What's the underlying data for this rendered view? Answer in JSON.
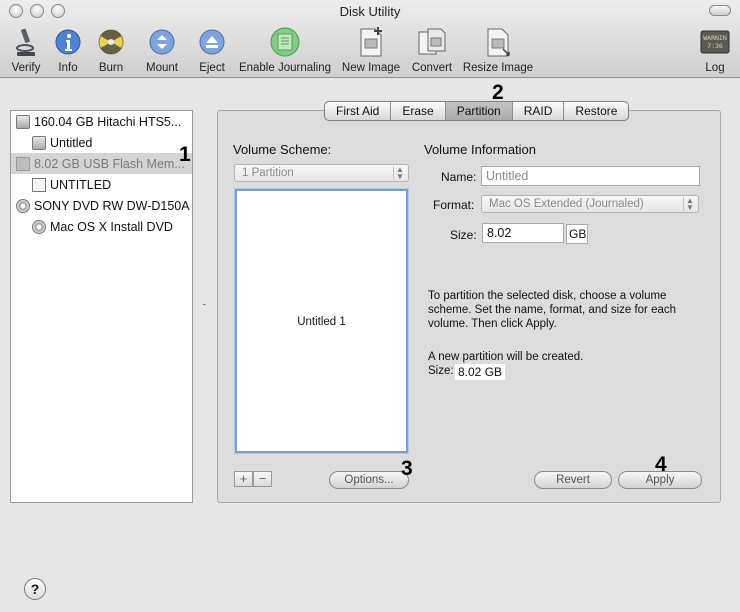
{
  "window": {
    "title": "Disk Utility"
  },
  "toolbar": [
    {
      "label": "Verify",
      "icon": "microscope-icon"
    },
    {
      "label": "Info",
      "icon": "info-icon"
    },
    {
      "label": "Burn",
      "icon": "burn-icon"
    },
    {
      "label": "Mount",
      "icon": "mount-icon"
    },
    {
      "label": "Eject",
      "icon": "eject-icon"
    },
    {
      "label": "Enable Journaling",
      "icon": "journaling-icon"
    },
    {
      "label": "New Image",
      "icon": "new-image-icon"
    },
    {
      "label": "Convert",
      "icon": "convert-icon"
    },
    {
      "label": "Resize Image",
      "icon": "resize-image-icon"
    },
    {
      "label": "Log",
      "icon": "log-icon",
      "icon_text": "WARNIN 7:36"
    }
  ],
  "sidebar": {
    "items": [
      {
        "label": "160.04 GB Hitachi HTS5...",
        "kind": "hard-disk"
      },
      {
        "label": "Untitled",
        "kind": "volume"
      },
      {
        "label": "8.02 GB USB Flash Mem...",
        "kind": "usb-drive",
        "selected": true
      },
      {
        "label": "UNTITLED",
        "kind": "volume"
      },
      {
        "label": "SONY DVD RW DW-D150A",
        "kind": "optical-drive"
      },
      {
        "label": "Mac OS X Install DVD",
        "kind": "disc"
      }
    ]
  },
  "tabs": [
    {
      "label": "First Aid"
    },
    {
      "label": "Erase"
    },
    {
      "label": "Partition",
      "active": true
    },
    {
      "label": "RAID"
    },
    {
      "label": "Restore"
    }
  ],
  "partition": {
    "scheme_label": "Volume Scheme:",
    "scheme_value": "1 Partition",
    "map_partition_name": "Untitled 1",
    "options_button": "Options...",
    "add_button": "+",
    "remove_button": "−",
    "volume_info_label": "Volume Information",
    "name_label": "Name:",
    "name_value": "Untitled",
    "format_label": "Format:",
    "format_value": "Mac OS Extended (Journaled)",
    "size_label": "Size:",
    "size_value": "8.02",
    "size_unit": "GB",
    "instructions": "To partition the selected disk, choose a volume scheme. Set the name, format, and size for each volume. Then click Apply.",
    "status": "A new partition will be created.",
    "status_size_label": "Size:",
    "status_size_value": "8.02 GB",
    "revert_button": "Revert",
    "apply_button": "Apply"
  },
  "callouts": [
    "1",
    "2",
    "3",
    "4"
  ],
  "help": {
    "label": "?"
  },
  "colors": {
    "selection": "#d4d4d4",
    "partition_border": "#7e9dc9",
    "panel": "#dcdcdc"
  }
}
